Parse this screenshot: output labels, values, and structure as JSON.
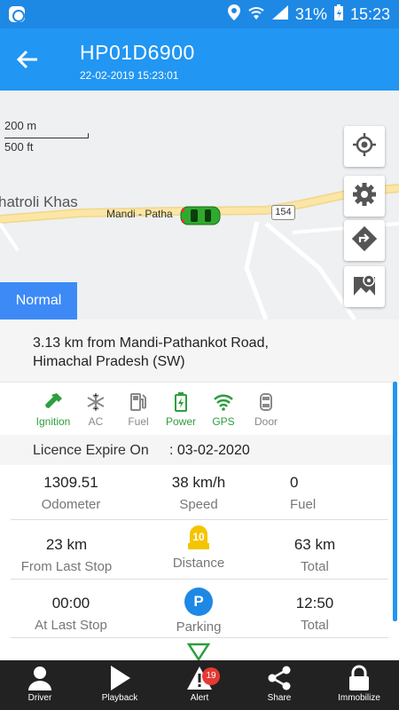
{
  "status": {
    "battery": "31%",
    "time": "15:23"
  },
  "header": {
    "title": "HP01D6900",
    "timestamp": "22-02-2019 15:23:01"
  },
  "map": {
    "scale_m": "200 m",
    "scale_ft": "500 ft",
    "place_label": "hatroli Khas",
    "road_label": "Mandi - Patha",
    "road_number": "154",
    "mode_button": "Normal"
  },
  "address": {
    "line1": "3.13 km from Mandi-Pathankot Road,",
    "line2": "Himachal Pradesh (SW)"
  },
  "sensors": [
    {
      "label": "Ignition",
      "icon": "key-icon",
      "color": "#2e9e3e"
    },
    {
      "label": "AC",
      "icon": "snowflake-icon",
      "color": "#888888"
    },
    {
      "label": "Fuel",
      "icon": "fuel-pump-icon",
      "color": "#888888"
    },
    {
      "label": "Power",
      "icon": "battery-icon",
      "color": "#2e9e3e"
    },
    {
      "label": "GPS",
      "icon": "wifi-icon",
      "color": "#2e9e3e"
    },
    {
      "label": "Door",
      "icon": "car-door-icon",
      "color": "#888888"
    }
  ],
  "licence": {
    "label": "Licence Expire On",
    "value": ": 03-02-2020"
  },
  "stats": {
    "odometer": {
      "value": "1309.51",
      "label": "Odometer"
    },
    "speed": {
      "value": "38 km/h",
      "label": "Speed"
    },
    "fuel": {
      "value": "0",
      "label": "Fuel"
    },
    "from_last_stop": {
      "value": "23 km",
      "label": "From Last Stop"
    },
    "distance": {
      "badge": "10",
      "label": "Distance"
    },
    "total_distance": {
      "value": "63 km",
      "label": "Total"
    },
    "at_last_stop": {
      "value": "00:00",
      "label": "At Last Stop"
    },
    "parking": {
      "icon_letter": "P",
      "label": "Parking"
    },
    "total_time": {
      "value": "12:50",
      "label": "Total"
    }
  },
  "nav": {
    "driver": "Driver",
    "playback": "Playback",
    "alert": "Alert",
    "alert_count": "19",
    "share": "Share",
    "immobilize": "Immobilize"
  }
}
